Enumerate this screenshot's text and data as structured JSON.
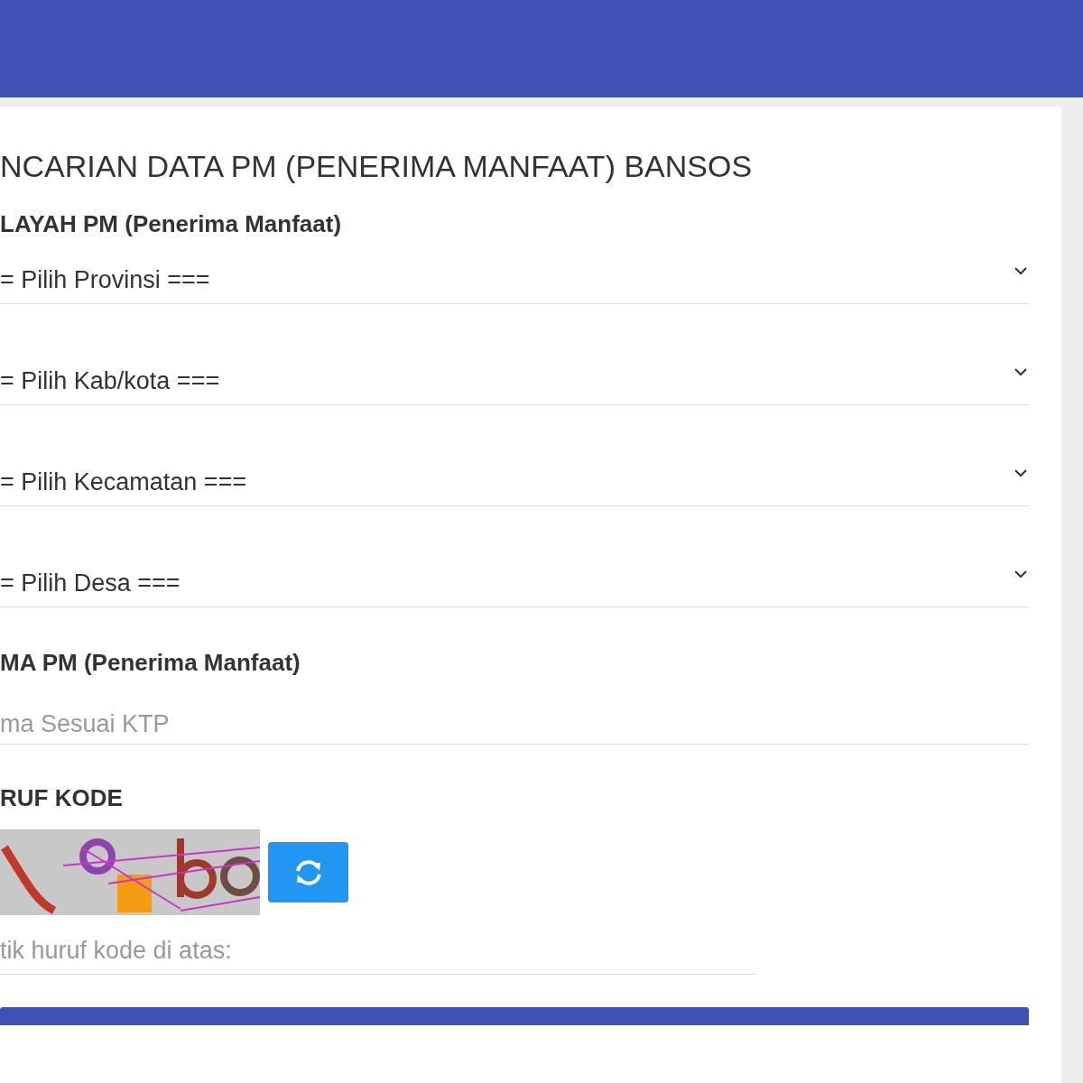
{
  "form": {
    "title": "NCARIAN DATA PM (PENERIMA MANFAAT) BANSOS",
    "region_section": {
      "heading": "LAYAH PM (Penerima Manfaat)",
      "selects": [
        {
          "value": "= Pilih Provinsi ==="
        },
        {
          "value": "= Pilih Kab/kota ==="
        },
        {
          "value": "= Pilih Kecamatan ==="
        },
        {
          "value": "= Pilih Desa ==="
        }
      ]
    },
    "name_section": {
      "heading": "MA PM (Penerima Manfaat)",
      "placeholder": "ma Sesuai KTP"
    },
    "captcha_section": {
      "heading": "RUF KODE",
      "placeholder": "tik huruf kode di atas:"
    }
  }
}
